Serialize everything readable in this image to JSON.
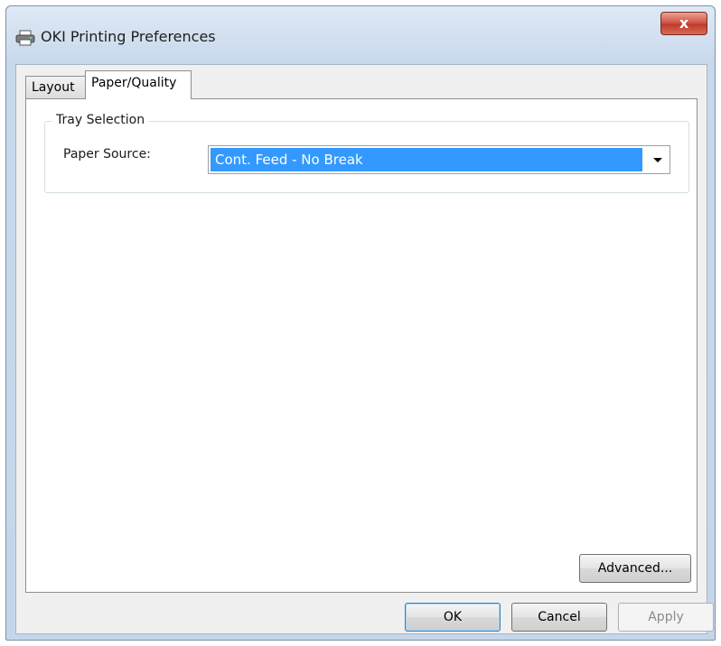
{
  "window": {
    "title": "OKI Printing Preferences",
    "close_label": "x"
  },
  "tabs": [
    {
      "label": "Layout",
      "active": false
    },
    {
      "label": "Paper/Quality",
      "active": true
    }
  ],
  "tray_selection": {
    "legend": "Tray Selection",
    "paper_source_label": "Paper Source:",
    "paper_source_value": "Cont. Feed - No Break"
  },
  "buttons": {
    "advanced": "Advanced...",
    "ok": "OK",
    "cancel": "Cancel",
    "apply": "Apply"
  },
  "colors": {
    "selection": "#3399ff",
    "close_button": "#c03b2c",
    "frame": "#c6d6ea"
  }
}
